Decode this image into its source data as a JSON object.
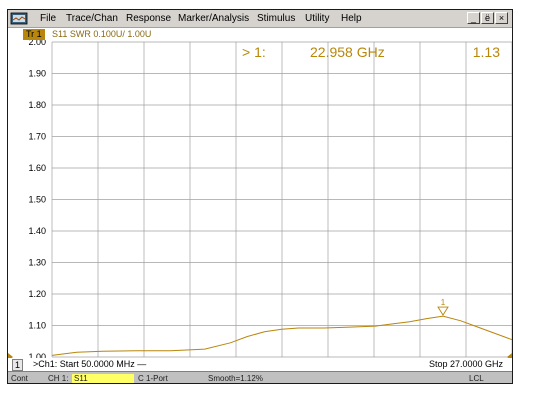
{
  "menu": [
    "File",
    "Trace/Chan",
    "Response",
    "Marker/Analysis",
    "Stimulus",
    "Utility",
    "Help"
  ],
  "window_buttons": {
    "minimize": "_",
    "restore": "ё",
    "close": "×"
  },
  "trace": {
    "badge": "Tr 1",
    "label": "S11 SWR 0.100U/ 1.00U"
  },
  "marker": {
    "readout_prefix": "> 1:",
    "frequency": "22.958 GHz",
    "value": "1.13",
    "label": "1"
  },
  "channel": {
    "number": "1",
    "start": ">Ch1: Start  50.0000 MHz —",
    "stop": "Stop  27.0000 GHz"
  },
  "status": {
    "mode": "Cont",
    "channel": "CH 1:",
    "param": "S11",
    "cal": "C 1-Port",
    "smooth": "Smooth=1.12%",
    "remote": "LCL"
  },
  "colors": {
    "trace": "#b8860b",
    "marker_text": "#b8860b",
    "grid": "#a0a0a0",
    "status_highlight": "#ffff66"
  },
  "chart_data": {
    "type": "line",
    "title": "",
    "xlabel": "",
    "ylabel": "",
    "xlim": [
      0.05,
      27.0
    ],
    "ylim": [
      1.0,
      2.0
    ],
    "yticks": [
      "2.00",
      "1.90",
      "1.80",
      "1.70",
      "1.60",
      "1.50",
      "1.40",
      "1.30",
      "1.20",
      "1.10",
      "1.00"
    ],
    "grid": true,
    "series": [
      {
        "x": [
          0.05,
          1.5,
          3.0,
          5.0,
          7.0,
          9.0,
          10.5,
          11.5,
          12.5,
          13.5,
          14.5,
          16.0,
          17.5,
          19.0,
          20.0,
          21.0,
          22.0,
          22.958,
          24.0,
          25.0,
          26.0,
          27.0
        ],
        "y": [
          1.005,
          1.015,
          1.018,
          1.02,
          1.02,
          1.025,
          1.045,
          1.065,
          1.08,
          1.088,
          1.092,
          1.092,
          1.095,
          1.098,
          1.105,
          1.112,
          1.122,
          1.13,
          1.115,
          1.095,
          1.075,
          1.055
        ]
      }
    ],
    "markers": [
      {
        "label": "1",
        "x": 22.958,
        "y": 1.13
      }
    ]
  }
}
